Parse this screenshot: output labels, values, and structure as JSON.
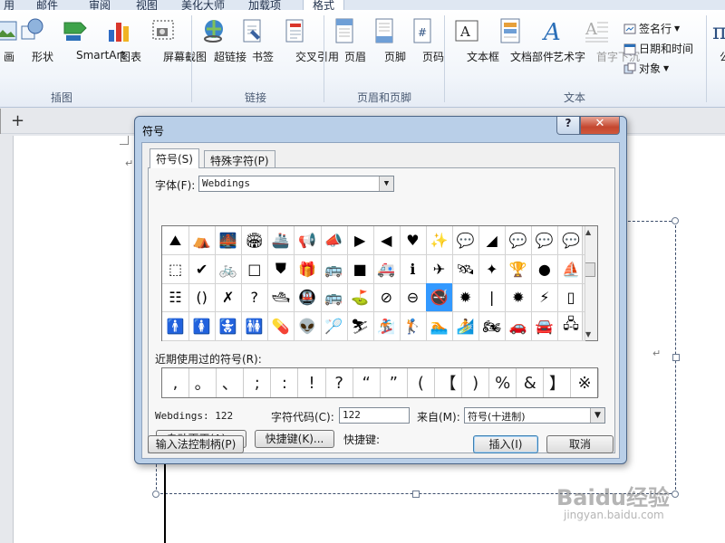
{
  "ribbon": {
    "tabs": [
      "用",
      "邮件",
      "审阅",
      "视图",
      "美化大师",
      "加载项",
      "格式"
    ],
    "buttons": [
      {
        "label": "画",
        "icon": "shapes-icon"
      },
      {
        "label": "形状",
        "icon": "shapes-icon"
      },
      {
        "label": "SmartArt",
        "icon": "smartart-icon"
      },
      {
        "label": "图表",
        "icon": "chart-icon"
      },
      {
        "label": "屏幕截图",
        "icon": "screenshot-icon"
      },
      {
        "label": "超链接",
        "icon": "hyperlink-icon"
      },
      {
        "label": "书签",
        "icon": "bookmark-icon"
      },
      {
        "label": "交叉引用",
        "icon": "cross-reference-icon"
      },
      {
        "label": "页眉",
        "icon": "header-icon"
      },
      {
        "label": "页脚",
        "icon": "footer-icon"
      },
      {
        "label": "页码",
        "icon": "page-number-icon"
      },
      {
        "label": "文本框",
        "icon": "textbox-icon"
      },
      {
        "label": "文档部件",
        "icon": "quick-parts-icon"
      },
      {
        "label": "艺术字",
        "icon": "wordart-icon"
      },
      {
        "label": "首字下沉",
        "icon": "drop-cap-icon"
      },
      {
        "label": "公",
        "icon": "equation-icon"
      }
    ],
    "small_buttons": [
      "签名行",
      "日期和时间",
      "对象"
    ],
    "groups": [
      "插图",
      "链接",
      "页眉和页脚",
      "文本"
    ]
  },
  "doc": {
    "new_tab_symbol": "+",
    "para_mark": "↵"
  },
  "dialog": {
    "title": "符号",
    "help": "?",
    "close": "✕",
    "tabs": [
      "符号(S)",
      "特殊字符(P)"
    ],
    "font_label": "字体(F):",
    "font_value": "Webdings",
    "grid_symbols": [
      [
        "⛰",
        "⛺",
        "🌉",
        "🏟",
        "🚢",
        "📢",
        "📣",
        "▶",
        "◀",
        "♥",
        "✨",
        "💬",
        "◢",
        "💬",
        "💬",
        "💬"
      ],
      [
        "⬚",
        "✔",
        "🚲",
        "□",
        "⛊",
        "🎁",
        "🚌",
        "■",
        "🚑",
        "ℹ",
        "✈",
        "🛰",
        "✦",
        "🏆",
        "●",
        "⛵"
      ],
      [
        "☷",
        "()",
        "✗",
        "?",
        "🛥",
        "🚇",
        "🚌",
        "⛳",
        "⊘",
        "⊖",
        "🚭",
        "✹",
        "|",
        "✹",
        "⚡",
        "▯"
      ],
      [
        "🚹",
        "🚺",
        "🚼",
        "🚻",
        "💊",
        "👽",
        "🏸",
        "⛷",
        "🏂",
        "🏌",
        "🏊",
        "🏄",
        "🏍",
        "🚗",
        "🚘",
        "🖧"
      ]
    ],
    "recent_label": "近期使用过的符号(R):",
    "recent_symbols": [
      ",",
      "。",
      "、",
      ";",
      ":",
      "!",
      "?",
      "“",
      "”",
      "(",
      "【",
      ")",
      "%",
      "&",
      "】",
      "※"
    ],
    "char_name": "Webdings: 122",
    "char_code_label": "字符代码(C):",
    "char_code_value": "122",
    "from_label": "来自(M):",
    "from_value": "符号(十进制)",
    "autocorrect_button": "自动更正(A)...",
    "shortcut_key_button": "快捷键(K)...",
    "shortcut_label": "快捷键:",
    "ime_button": "输入法控制柄(P)",
    "insert_button": "插入(I)",
    "cancel_button": "取消"
  },
  "watermark": {
    "brand": "Baidu经验",
    "url": "jingyan.baidu.com"
  },
  "colors": {
    "selection": "#3399ff",
    "dialog_frame": "#b9cfe8",
    "close_button": "#c4472f"
  }
}
